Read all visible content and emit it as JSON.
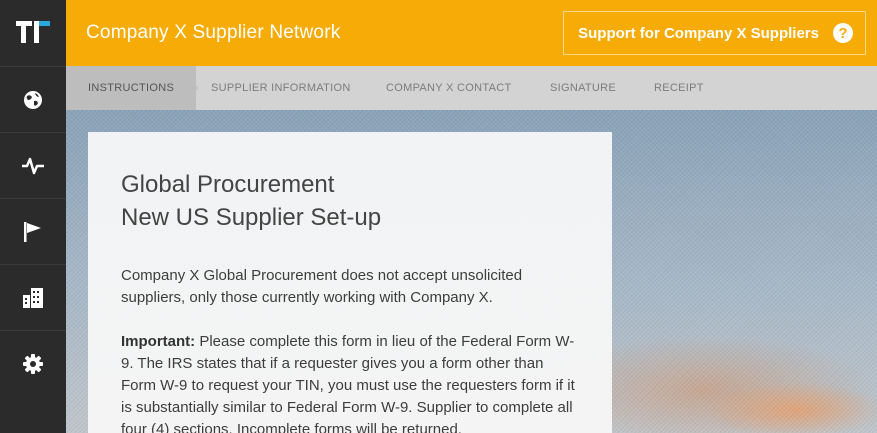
{
  "app": {
    "title": "Company X Supplier Network"
  },
  "support": {
    "label": "Support for Company X Suppliers",
    "help_glyph": "?"
  },
  "sidebar": {
    "logo": "logo-icon",
    "items": [
      {
        "icon": "globe-icon"
      },
      {
        "icon": "activity-icon"
      },
      {
        "icon": "flag-icon"
      },
      {
        "icon": "buildings-icon"
      },
      {
        "icon": "gear-icon"
      }
    ]
  },
  "steps": [
    {
      "label": "INSTRUCTIONS",
      "active": true
    },
    {
      "label": "SUPPLIER INFORMATION",
      "active": false
    },
    {
      "label": "COMPANY X CONTACT",
      "active": false
    },
    {
      "label": "SIGNATURE",
      "active": false
    },
    {
      "label": "RECEIPT",
      "active": false
    }
  ],
  "card": {
    "title_line1": "Global Procurement",
    "title_line2": "New US Supplier Set-up",
    "intro": "Company X Global Procurement does not accept unsolicited suppliers, only those currently working with Company X.",
    "important_label": "Important:",
    "important_text": " Please complete this form in lieu of the Federal Form W-9. The IRS states that if a requester gives you a form other than Form W-9 to request your TIN, you must use the requesters form if it is substantially similar to Federal Form W-9. Supplier to complete all four (4) sections. Incomplete forms will be returned."
  },
  "colors": {
    "accent": "#f6ab06",
    "sidebar": "#2b2b2b",
    "stepbar": "#d3d3d3"
  }
}
